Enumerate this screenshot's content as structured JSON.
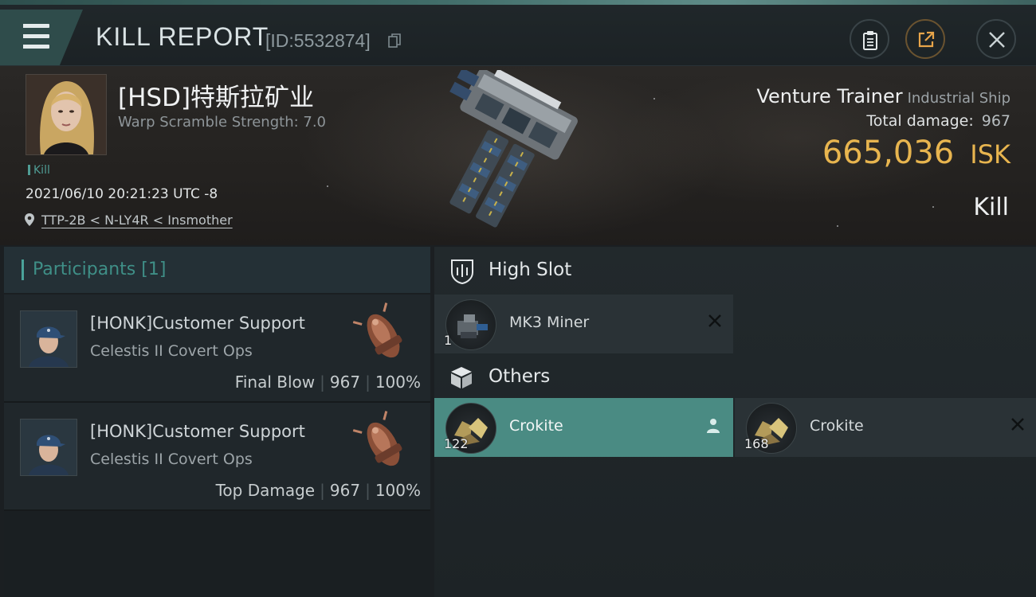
{
  "header": {
    "title": "KILL REPORT",
    "report_id": "[ID:5532874]",
    "icons": [
      "menu-icon",
      "copy-icon",
      "clipboard-icon",
      "share-icon",
      "close-icon"
    ]
  },
  "victim": {
    "name": "[HSD]特斯拉矿业",
    "warp_scramble": "Warp Scramble Strength: 7.0",
    "kill_tag": "Kill",
    "datetime": "2021/06/10 20:21:23 UTC -8",
    "location": "TTP-2B < N-LY4R < Insmother"
  },
  "ship": {
    "name": "Venture Trainer",
    "class": "Industrial Ship",
    "total_damage_label": "Total damage:",
    "total_damage_value": "967",
    "isk_value": "665,036",
    "isk_unit": "ISK",
    "kill_type": "Kill"
  },
  "participants": {
    "label": "Participants",
    "count": "[1]",
    "items": [
      {
        "name": "[HONK]Customer Support",
        "ship": "Celestis II Covert Ops",
        "role": "Final Blow",
        "damage": "967",
        "percent": "100%"
      },
      {
        "name": "[HONK]Customer Support",
        "ship": "Celestis II Covert Ops",
        "role": "Top Damage",
        "damage": "967",
        "percent": "100%"
      }
    ]
  },
  "fitting": {
    "high_slot": {
      "label": "High Slot",
      "items": [
        {
          "name": "MK3 Miner",
          "qty": "1"
        }
      ]
    },
    "others": {
      "label": "Others",
      "items": [
        {
          "name": "Crokite",
          "qty": "122"
        },
        {
          "name": "Crokite",
          "qty": "168"
        }
      ]
    }
  },
  "colors": {
    "accent_teal": "#4a8b83",
    "isk_gold": "#e8b54f",
    "header_teal": "#2f4c4b"
  }
}
